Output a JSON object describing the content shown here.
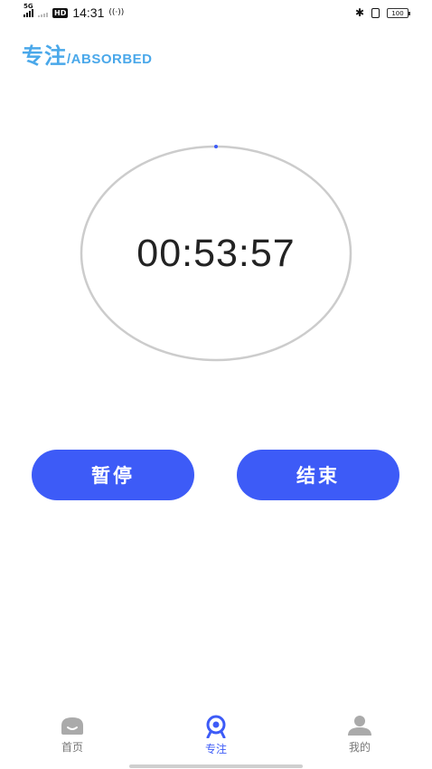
{
  "status_bar": {
    "network": "5G",
    "hd": "HD",
    "time": "14:31",
    "battery": "100"
  },
  "header": {
    "title_cn": "专注",
    "title_en": "/ABSORBED"
  },
  "timer": {
    "display": "00:53:57"
  },
  "buttons": {
    "pause": "暂停",
    "end": "结束"
  },
  "nav": {
    "items": [
      {
        "label": "首页"
      },
      {
        "label": "专注"
      },
      {
        "label": "我的"
      }
    ],
    "active_index": 1
  },
  "colors": {
    "accent": "#3d5bf7",
    "header": "#4aa8ea",
    "ring": "#cccccc",
    "nav_inactive": "#aaaaaa"
  }
}
